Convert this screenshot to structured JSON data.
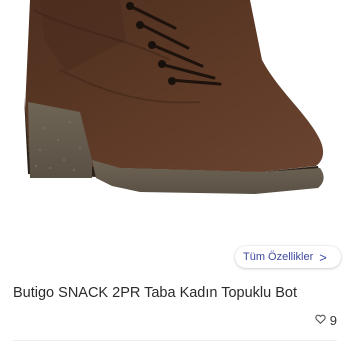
{
  "product": {
    "title": "Butigo SNACK 2PR Taba Kadın Topuklu Bot",
    "features_link": "Tüm Özellikler",
    "features_chevron": ">",
    "likes": "9"
  },
  "colors": {
    "leather": "#5a3726",
    "sole": "#6e6355",
    "accent": "#3f4aa0"
  },
  "icons": {
    "like": "heart-outline-icon",
    "chevron": "chevron-right-icon"
  }
}
